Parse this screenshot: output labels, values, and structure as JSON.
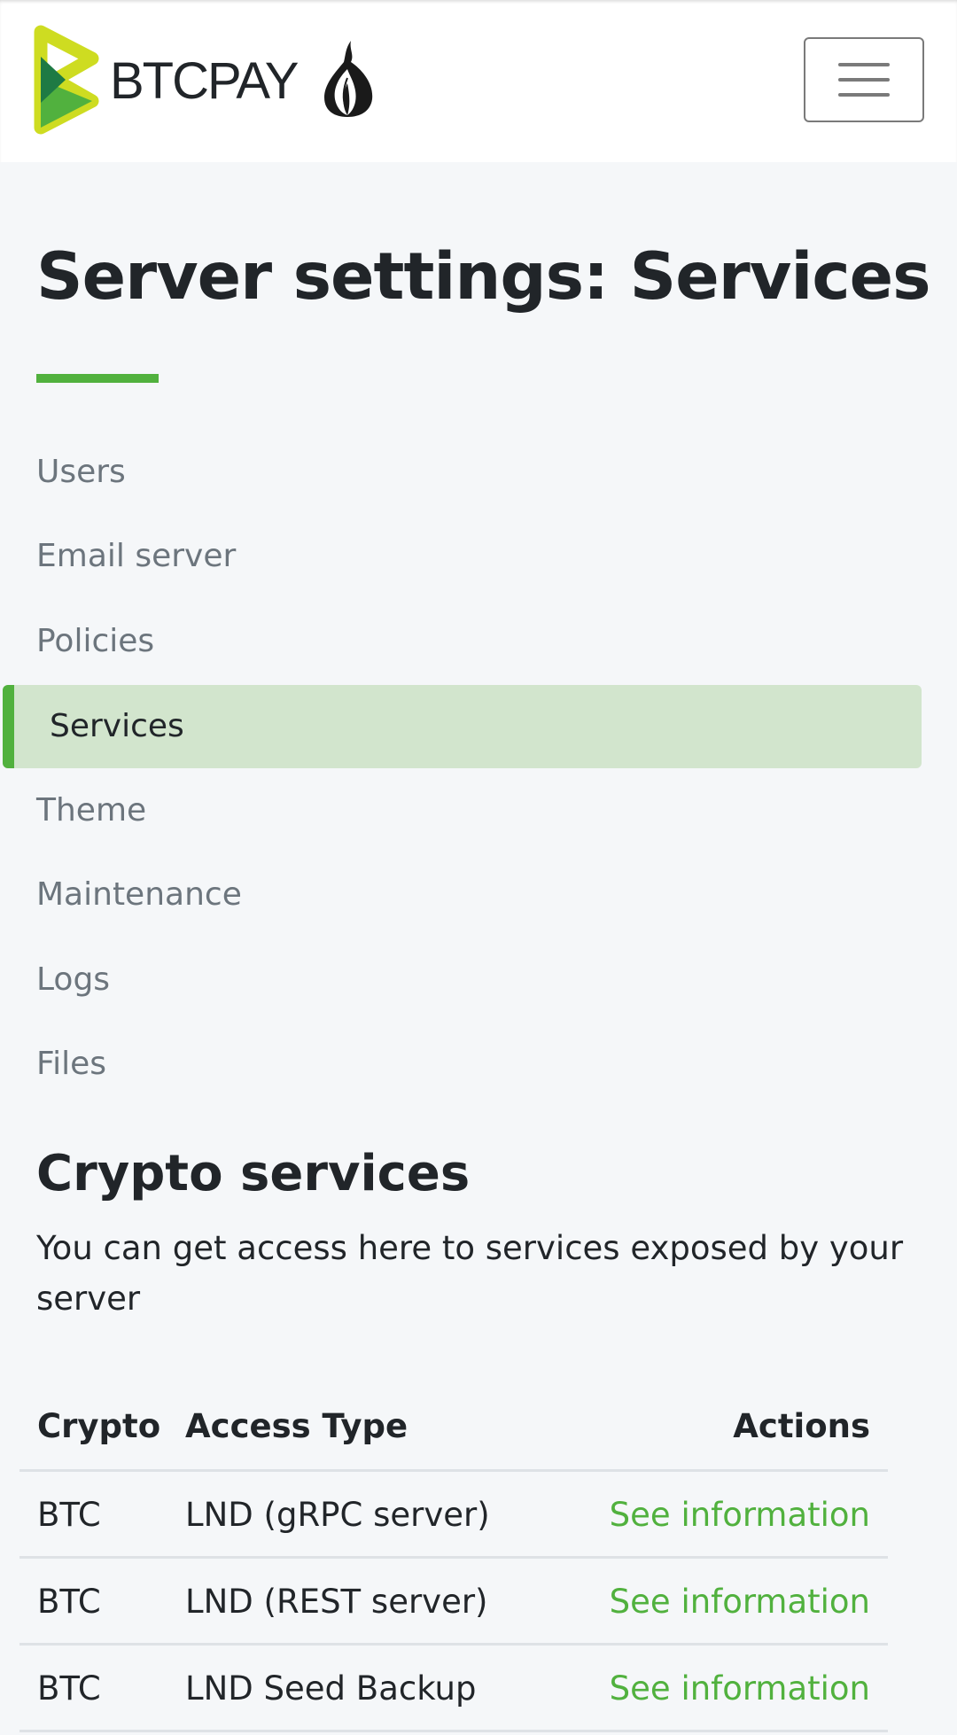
{
  "header": {
    "brand_text": "BTCPAY",
    "menu_toggle_icon": "hamburger-menu-icon",
    "tor_icon": "onion-icon"
  },
  "page": {
    "title": "Server settings: Services"
  },
  "nav": {
    "items": [
      {
        "label": "Users"
      },
      {
        "label": "Email server"
      },
      {
        "label": "Policies"
      },
      {
        "label": "Services",
        "active": true
      },
      {
        "label": "Theme"
      },
      {
        "label": "Maintenance"
      },
      {
        "label": "Logs"
      },
      {
        "label": "Files"
      }
    ]
  },
  "crypto_services": {
    "title": "Crypto services",
    "description": "You can get access here to services exposed by your server",
    "table": {
      "headers": {
        "crypto": "Crypto",
        "access_type": "Access Type",
        "actions": "Actions"
      },
      "rows": [
        {
          "crypto": "BTC",
          "access_type": "LND (gRPC server)",
          "action": "See information"
        },
        {
          "crypto": "BTC",
          "access_type": "LND (REST server)",
          "action": "See information"
        },
        {
          "crypto": "BTC",
          "access_type": "LND Seed Backup",
          "action": "See information"
        }
      ]
    }
  },
  "colors": {
    "accent": "#51b13e",
    "active_nav_bg": "#d2e5cd",
    "page_bg": "#f5f7f9",
    "muted_text": "#6c757d"
  }
}
